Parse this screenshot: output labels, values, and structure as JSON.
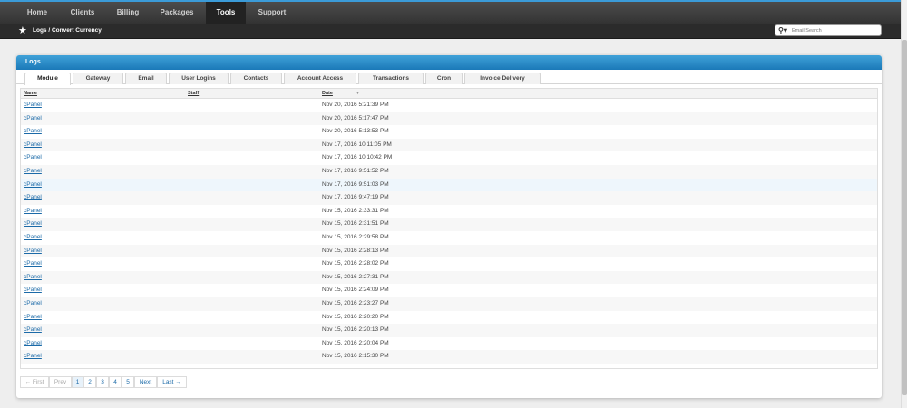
{
  "nav": {
    "items": [
      {
        "label": "Home"
      },
      {
        "label": "Clients"
      },
      {
        "label": "Billing"
      },
      {
        "label": "Packages"
      },
      {
        "label": "Tools",
        "active": true
      },
      {
        "label": "Support"
      }
    ]
  },
  "breadcrumb": {
    "icon": "star-icon",
    "text": "Logs / Convert Currency"
  },
  "search": {
    "placeholder": "Email Search",
    "icon": "search-icon"
  },
  "panel": {
    "title": "Logs",
    "tabs": [
      {
        "label": "Module",
        "active": true
      },
      {
        "label": "Gateway"
      },
      {
        "label": "Email"
      },
      {
        "label": "User Logins"
      },
      {
        "label": "Contacts"
      },
      {
        "label": "Account Access"
      },
      {
        "label": "Transactions"
      },
      {
        "label": "Cron"
      },
      {
        "label": "Invoice Delivery"
      }
    ],
    "table": {
      "headers": {
        "name": "Name",
        "staff": "Staff",
        "date": "Date"
      },
      "sort_icon": "caret-down-icon",
      "rows": [
        {
          "name": "cPanel",
          "staff": "",
          "date": "Nov 20, 2016 5:21:39 PM"
        },
        {
          "name": "cPanel",
          "staff": "",
          "date": "Nov 20, 2016 5:17:47 PM"
        },
        {
          "name": "cPanel",
          "staff": "",
          "date": "Nov 20, 2016 5:13:53 PM"
        },
        {
          "name": "cPanel",
          "staff": "",
          "date": "Nov 17, 2016 10:11:05 PM"
        },
        {
          "name": "cPanel",
          "staff": "",
          "date": "Nov 17, 2016 10:10:42 PM"
        },
        {
          "name": "cPanel",
          "staff": "",
          "date": "Nov 17, 2016 9:51:52 PM"
        },
        {
          "name": "cPanel",
          "staff": "",
          "date": "Nov 17, 2016 9:51:03 PM"
        },
        {
          "name": "cPanel",
          "staff": "",
          "date": "Nov 17, 2016 9:47:19 PM"
        },
        {
          "name": "cPanel",
          "staff": "",
          "date": "Nov 15, 2016 2:33:31 PM"
        },
        {
          "name": "cPanel",
          "staff": "",
          "date": "Nov 15, 2016 2:31:51 PM"
        },
        {
          "name": "cPanel",
          "staff": "",
          "date": "Nov 15, 2016 2:29:58 PM"
        },
        {
          "name": "cPanel",
          "staff": "",
          "date": "Nov 15, 2016 2:28:13 PM"
        },
        {
          "name": "cPanel",
          "staff": "",
          "date": "Nov 15, 2016 2:28:02 PM"
        },
        {
          "name": "cPanel",
          "staff": "",
          "date": "Nov 15, 2016 2:27:31 PM"
        },
        {
          "name": "cPanel",
          "staff": "",
          "date": "Nov 15, 2016 2:24:09 PM"
        },
        {
          "name": "cPanel",
          "staff": "",
          "date": "Nov 15, 2016 2:23:27 PM"
        },
        {
          "name": "cPanel",
          "staff": "",
          "date": "Nov 15, 2016 2:20:20 PM"
        },
        {
          "name": "cPanel",
          "staff": "",
          "date": "Nov 15, 2016 2:20:13 PM"
        },
        {
          "name": "cPanel",
          "staff": "",
          "date": "Nov 15, 2016 2:20:04 PM"
        },
        {
          "name": "cPanel",
          "staff": "",
          "date": "Nov 15, 2016 2:15:30 PM"
        }
      ]
    },
    "pagination": {
      "first": "← First",
      "prev": "Prev",
      "pages": [
        "1",
        "2",
        "3",
        "4",
        "5"
      ],
      "current": "1",
      "next": "Next",
      "last": "Last →"
    }
  },
  "colors": {
    "accent": "#3b9bd8",
    "panel_header": "#1b79b8",
    "link": "#1b6aa8",
    "nav_bg": "#333333"
  }
}
